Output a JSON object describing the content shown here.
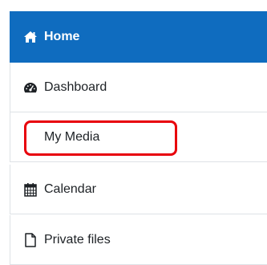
{
  "nav": {
    "items": [
      {
        "label": "Home",
        "icon": "home-icon",
        "active": true
      },
      {
        "label": "Dashboard",
        "icon": "dashboard-icon",
        "active": false
      },
      {
        "label": "My Media",
        "icon": "",
        "active": false
      },
      {
        "label": "Calendar",
        "icon": "calendar-icon",
        "active": false
      },
      {
        "label": "Private files",
        "icon": "file-icon",
        "active": false
      }
    ]
  },
  "colors": {
    "active_background": "#0f6cbf",
    "highlight_border": "#e8000b",
    "divider": "#dee2e6"
  }
}
